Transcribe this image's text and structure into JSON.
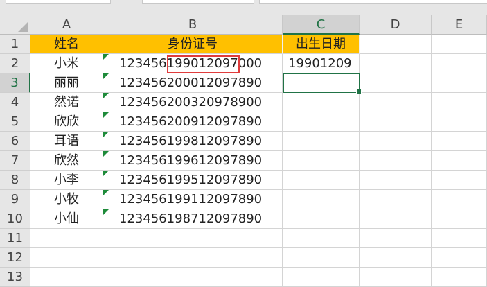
{
  "columns": [
    "A",
    "B",
    "C",
    "D",
    "E"
  ],
  "rows": [
    "1",
    "2",
    "3",
    "4",
    "5",
    "6",
    "7",
    "8",
    "9",
    "10",
    "11",
    "12",
    "13"
  ],
  "header": {
    "name": "姓名",
    "id": "身份证号",
    "birth": "出生日期"
  },
  "records": [
    {
      "name": "小米",
      "id": "123456199012097000",
      "birth": "19901209"
    },
    {
      "name": "丽丽",
      "id": "123456200012097890",
      "birth": ""
    },
    {
      "name": "然诺",
      "id": "123456200320978900",
      "birth": ""
    },
    {
      "name": "欣欣",
      "id": "123456200912097890",
      "birth": ""
    },
    {
      "name": "耳语",
      "id": "123456199812097890",
      "birth": ""
    },
    {
      "name": "欣然",
      "id": "123456199612097890",
      "birth": ""
    },
    {
      "name": "小李",
      "id": "123456199512097890",
      "birth": ""
    },
    {
      "name": "小牧",
      "id": "123456199112097890",
      "birth": ""
    },
    {
      "name": "小仙",
      "id": "123456198712097890",
      "birth": ""
    }
  ],
  "active_cell": "C3",
  "colors": {
    "header_fill": "#ffc000",
    "selection": "#217346",
    "highlight_box": "#e03c3c",
    "error_triangle": "#1e8b3a"
  }
}
